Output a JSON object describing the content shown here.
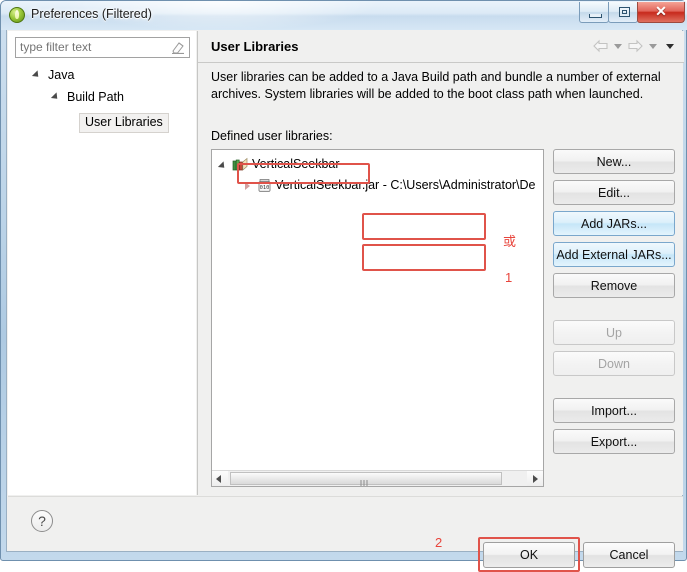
{
  "window": {
    "title": "Preferences (Filtered)",
    "icon": "eclipse-circle-icon",
    "controls": {
      "minimize": "minimize-icon",
      "maximize": "maximize-icon",
      "close": "✕"
    }
  },
  "sidebar": {
    "filter": {
      "value": "",
      "placeholder": "type filter text",
      "clear_icon": "eraser-icon"
    },
    "tree": [
      {
        "label": "Java",
        "expanded": true,
        "level": 0,
        "selected": false
      },
      {
        "label": "Build Path",
        "expanded": true,
        "level": 1,
        "selected": false
      },
      {
        "label": "User Libraries",
        "expanded": false,
        "level": 2,
        "selected": true
      }
    ]
  },
  "page": {
    "title": "User Libraries",
    "description": "User libraries can be added to a Java Build path and bundle a number of external archives. System libraries will be added to the boot class path when launched.",
    "defined_label": "Defined user libraries:",
    "nav": {
      "back_icon": "arrow-left-icon",
      "back_menu_icon": "chevron-down-icon",
      "forward_icon": "arrow-right-icon",
      "forward_menu_icon": "chevron-down-icon",
      "view_menu_icon": "chevron-down-icon"
    }
  },
  "libraries": [
    {
      "label": "VerticalSeekbar",
      "icon": "user-library-books-icon",
      "expanded": true,
      "level": 0
    },
    {
      "label": "VerticalSeekbar.jar - C:\\Users\\Administrator\\De",
      "icon": "jar-archive-icon",
      "expanded": false,
      "level": 1
    }
  ],
  "scrollbar": {
    "left_arrow": "arrow-left-icon",
    "right_arrow": "arrow-right-icon",
    "grip": "grip-icon"
  },
  "side_buttons": [
    {
      "label": "New...",
      "state": "normal"
    },
    {
      "label": "Edit...",
      "state": "normal"
    },
    {
      "label": "Add JARs...",
      "state": "highlighted"
    },
    {
      "label": "Add External JARs...",
      "state": "highlighted"
    },
    {
      "label": "Remove",
      "state": "normal"
    },
    {
      "label": "Up",
      "state": "disabled"
    },
    {
      "label": "Down",
      "state": "disabled"
    },
    {
      "label": "Import...",
      "state": "normal"
    },
    {
      "label": "Export...",
      "state": "normal"
    }
  ],
  "annotations": {
    "or_marker": "或",
    "step_one": "1",
    "step_two": "2",
    "color": "#e8453c"
  },
  "footer": {
    "help_label": "?",
    "ok_label": "OK",
    "cancel_label": "Cancel"
  }
}
